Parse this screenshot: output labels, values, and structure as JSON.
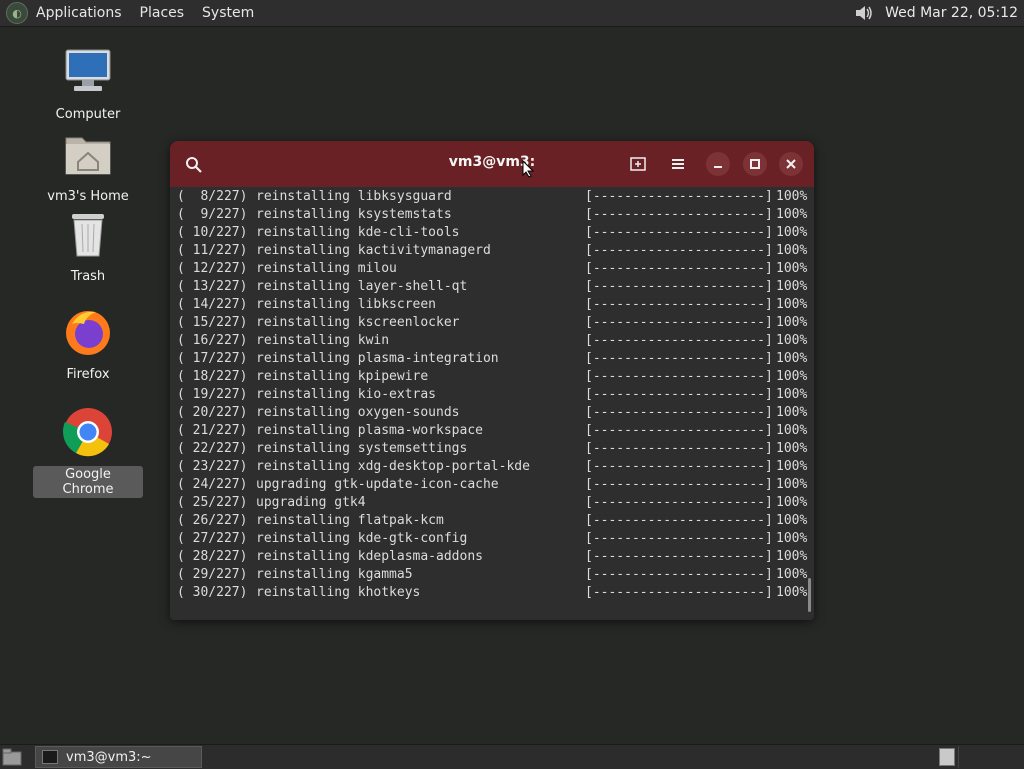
{
  "top_panel": {
    "menus": [
      "Applications",
      "Places",
      "System"
    ],
    "clock": "Wed Mar 22, 05:12",
    "icons": {
      "logo": "distro-logo-icon",
      "volume": "speaker-volume-icon"
    }
  },
  "desktop_icons": [
    {
      "label": "Computer",
      "icon": "computer-monitor-icon"
    },
    {
      "label": "vm3's Home",
      "icon": "home-folder-icon"
    },
    {
      "label": "Trash",
      "icon": "trash-icon"
    },
    {
      "label": "Firefox",
      "icon": "firefox-icon"
    },
    {
      "label": "Google Chrome",
      "icon": "chrome-icon",
      "selected": true
    }
  ],
  "terminal": {
    "title": "vm3@vm3:~",
    "title_display": "vm3@vm3:",
    "header_color": "#6a2125",
    "lines": [
      {
        "index": "(  8/227)",
        "action": "reinstalling libksysguard",
        "bar": "[----------------------]",
        "percent": "100%"
      },
      {
        "index": "(  9/227)",
        "action": "reinstalling ksystemstats",
        "bar": "[----------------------]",
        "percent": "100%"
      },
      {
        "index": "( 10/227)",
        "action": "reinstalling kde-cli-tools",
        "bar": "[----------------------]",
        "percent": "100%"
      },
      {
        "index": "( 11/227)",
        "action": "reinstalling kactivitymanagerd",
        "bar": "[----------------------]",
        "percent": "100%"
      },
      {
        "index": "( 12/227)",
        "action": "reinstalling milou",
        "bar": "[----------------------]",
        "percent": "100%"
      },
      {
        "index": "( 13/227)",
        "action": "reinstalling layer-shell-qt",
        "bar": "[----------------------]",
        "percent": "100%"
      },
      {
        "index": "( 14/227)",
        "action": "reinstalling libkscreen",
        "bar": "[----------------------]",
        "percent": "100%"
      },
      {
        "index": "( 15/227)",
        "action": "reinstalling kscreenlocker",
        "bar": "[----------------------]",
        "percent": "100%"
      },
      {
        "index": "( 16/227)",
        "action": "reinstalling kwin",
        "bar": "[----------------------]",
        "percent": "100%"
      },
      {
        "index": "( 17/227)",
        "action": "reinstalling plasma-integration",
        "bar": "[----------------------]",
        "percent": "100%"
      },
      {
        "index": "( 18/227)",
        "action": "reinstalling kpipewire",
        "bar": "[----------------------]",
        "percent": "100%"
      },
      {
        "index": "( 19/227)",
        "action": "reinstalling kio-extras",
        "bar": "[----------------------]",
        "percent": "100%"
      },
      {
        "index": "( 20/227)",
        "action": "reinstalling oxygen-sounds",
        "bar": "[----------------------]",
        "percent": "100%"
      },
      {
        "index": "( 21/227)",
        "action": "reinstalling plasma-workspace",
        "bar": "[----------------------]",
        "percent": "100%"
      },
      {
        "index": "( 22/227)",
        "action": "reinstalling systemsettings",
        "bar": "[----------------------]",
        "percent": "100%"
      },
      {
        "index": "( 23/227)",
        "action": "reinstalling xdg-desktop-portal-kde",
        "bar": "[----------------------]",
        "percent": "100%"
      },
      {
        "index": "( 24/227)",
        "action": "upgrading gtk-update-icon-cache",
        "bar": "[----------------------]",
        "percent": "100%"
      },
      {
        "index": "( 25/227)",
        "action": "upgrading gtk4",
        "bar": "[----------------------]",
        "percent": "100%"
      },
      {
        "index": "( 26/227)",
        "action": "reinstalling flatpak-kcm",
        "bar": "[----------------------]",
        "percent": "100%"
      },
      {
        "index": "( 27/227)",
        "action": "reinstalling kde-gtk-config",
        "bar": "[----------------------]",
        "percent": "100%"
      },
      {
        "index": "( 28/227)",
        "action": "reinstalling kdeplasma-addons",
        "bar": "[----------------------]",
        "percent": "100%"
      },
      {
        "index": "( 29/227)",
        "action": "reinstalling kgamma5",
        "bar": "[----------------------]",
        "percent": "100%"
      },
      {
        "index": "( 30/227)",
        "action": "reinstalling khotkeys",
        "bar": "[----------------------]",
        "percent": "100%"
      }
    ]
  },
  "bottom_panel": {
    "task_label": "vm3@vm3:~",
    "icons": {
      "show_desktop": "show-desktop-icon",
      "task": "terminal-icon"
    }
  }
}
